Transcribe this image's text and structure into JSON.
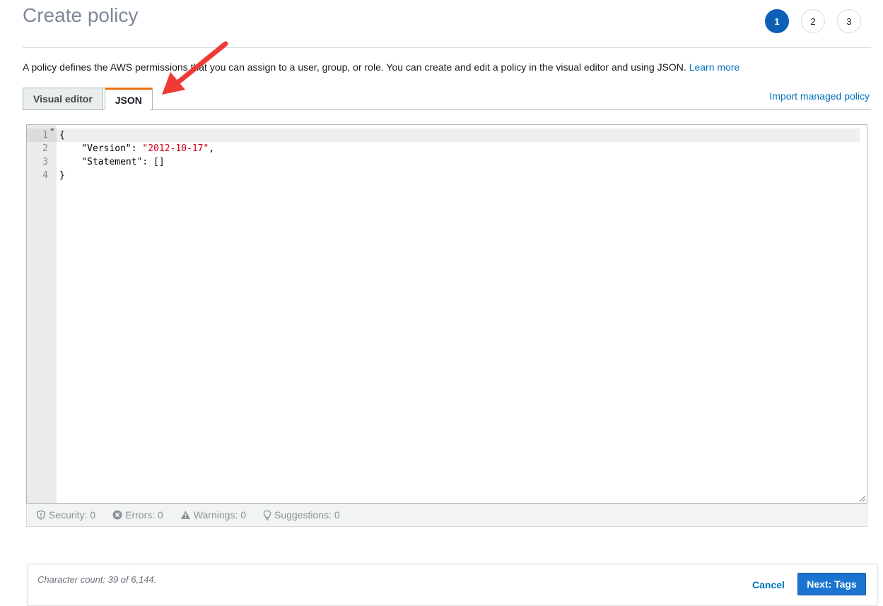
{
  "header": {
    "title": "Create policy",
    "steps": [
      "1",
      "2",
      "3"
    ],
    "active_step": "1"
  },
  "description": {
    "text": "A policy defines the AWS permissions that you can assign to a user, group, or role. You can create and edit a policy in the visual editor and using JSON.",
    "link": "Learn more"
  },
  "tabs": [
    {
      "label": "Visual editor",
      "active": false
    },
    {
      "label": "JSON",
      "active": true
    }
  ],
  "import_link": "Import managed policy",
  "editor": {
    "line_numbers": [
      "1",
      "2",
      "3",
      "4"
    ],
    "lines": [
      {
        "text": "{"
      },
      {
        "key": "    \"Version\": ",
        "value": "\"2012-10-17\"",
        "suffix": ","
      },
      {
        "text": "    \"Statement\": []"
      },
      {
        "text": "}"
      }
    ]
  },
  "status_bar": {
    "security": "Security: 0",
    "errors": "Errors: 0",
    "warnings": "Warnings: 0",
    "suggestions": "Suggestions: 0"
  },
  "footer": {
    "char_count": "Character count: 39 of 6,144.",
    "cancel": "Cancel",
    "next": "Next: Tags"
  },
  "colors": {
    "primary": "#0d60b6",
    "link": "#0073bb",
    "tab_accent": "#ec7211",
    "annotation_arrow": "#ee3b36",
    "string": "#d0021b"
  }
}
